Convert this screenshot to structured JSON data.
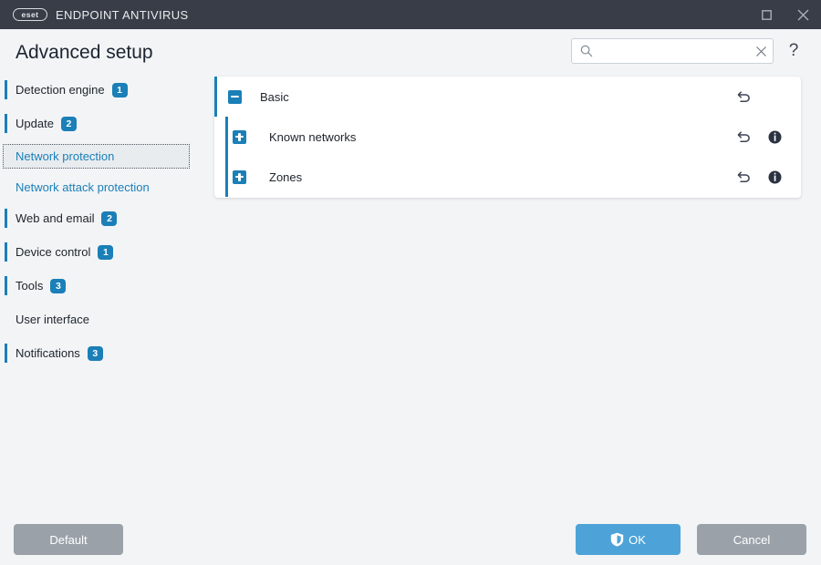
{
  "titlebar": {
    "logo_text": "eset",
    "app_title": "ENDPOINT ANTIVIRUS",
    "maximize_icon": "maximize-icon",
    "close_icon": "close-icon"
  },
  "header": {
    "page_title": "Advanced setup",
    "search": {
      "value": "",
      "placeholder": "",
      "search_icon": "search-icon",
      "clear_icon": "clear-x-icon"
    },
    "help_label": "?"
  },
  "sidebar": {
    "items": [
      {
        "label": "Detection engine",
        "badge": "1",
        "accent": true,
        "selected": false,
        "sub": false
      },
      {
        "label": "Update",
        "badge": "2",
        "accent": true,
        "selected": false,
        "sub": false
      },
      {
        "label": "Network protection",
        "badge": "",
        "accent": false,
        "selected": true,
        "sub": false
      },
      {
        "label": "Network attack protection",
        "badge": "",
        "accent": false,
        "selected": false,
        "sub": true
      },
      {
        "label": "Web and email",
        "badge": "2",
        "accent": true,
        "selected": false,
        "sub": false
      },
      {
        "label": "Device control",
        "badge": "1",
        "accent": true,
        "selected": false,
        "sub": false
      },
      {
        "label": "Tools",
        "badge": "3",
        "accent": true,
        "selected": false,
        "sub": false
      },
      {
        "label": "User interface",
        "badge": "",
        "accent": false,
        "selected": false,
        "sub": false
      },
      {
        "label": "Notifications",
        "badge": "3",
        "accent": true,
        "selected": false,
        "sub": false
      }
    ]
  },
  "panel": {
    "rows": [
      {
        "label": "Basic",
        "state": "expanded",
        "toggle_icon": "collapse-minus-icon",
        "level": 0,
        "has_revert": true,
        "has_info": false
      },
      {
        "label": "Known networks",
        "state": "collapsed",
        "toggle_icon": "expand-plus-icon",
        "level": 1,
        "has_revert": true,
        "has_info": true
      },
      {
        "label": "Zones",
        "state": "collapsed",
        "toggle_icon": "expand-plus-icon",
        "level": 1,
        "has_revert": true,
        "has_info": true
      }
    ],
    "revert_icon": "undo-arrow-icon",
    "info_icon": "info-circle-icon"
  },
  "footer": {
    "default_label": "Default",
    "ok_label": "OK",
    "ok_icon": "shield-icon",
    "cancel_label": "Cancel"
  },
  "colors": {
    "titlebar_bg": "#383d47",
    "page_bg": "#f2f4f6",
    "accent_blue": "#1b7fb8",
    "ok_blue": "#4da3d8",
    "grey_button": "#9aa1a9",
    "panel_bg": "#ffffff"
  }
}
